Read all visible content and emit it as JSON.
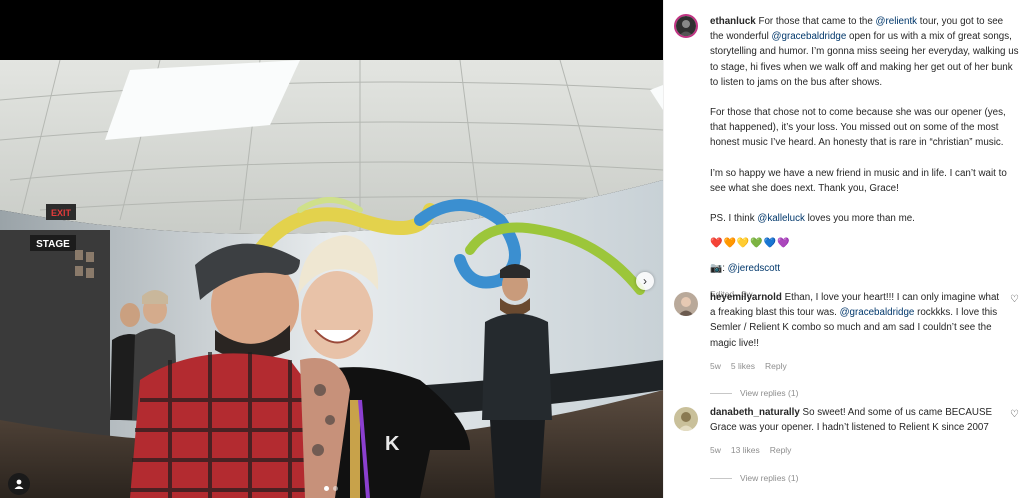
{
  "post": {
    "username": "ethanluck",
    "caption_p1_a": " For those that came to the ",
    "caption_p1_mention1": "@relientk",
    "caption_p1_b": " tour, you got to see the wonderful ",
    "caption_p1_mention2": "@gracebaldridge",
    "caption_p1_c": " open for us with a mix of great songs, storytelling and humor. I’m gonna miss seeing her everyday, walking us to stage, hi fives when we walk off and making her get out of her bunk to listen to jams on the bus after shows.",
    "caption_p2": "For those that chose not to come because she was our opener (yes, that happened), it’s your loss. You missed out on some of the most honest music I’ve heard. An honesty that is rare in “christian” music.",
    "caption_p3": "I’m so happy we have a new friend in music and in life. I can’t wait to see what she does next. Thank you, Grace!",
    "caption_p4_a": "PS. I think ",
    "caption_p4_mention": "@kalleluck",
    "caption_p4_b": " loves you more than me.",
    "hearts": "❤️🧡💛💚💙💜",
    "credit_emoji": "📷",
    "credit_sep": ": ",
    "credit_mention": "@jeredscott",
    "edited": "Edited · 5w"
  },
  "comments": [
    {
      "username": "heyemilyarnold",
      "text_a": " Ethan, I love your heart!!! I can only imagine what a freaking blast this tour was. ",
      "mention": "@gracebaldridge",
      "text_b": " rockkks. I love this Semler / Relient K combo so much and am sad I couldn’t see the magic live!!",
      "age": "5w",
      "likes": "5 likes",
      "reply": "Reply",
      "view_replies": "View replies (1)"
    },
    {
      "username": "danabeth_naturally",
      "text_a": " So sweet! And some of us came BECAUSE Grace was your opener. I hadn’t listened to Relient K since 2007",
      "mention": "",
      "text_b": "",
      "age": "5w",
      "likes": "13 likes",
      "reply": "Reply",
      "view_replies": "View replies (1)"
    }
  ],
  "photo": {
    "exit_sign": "EXIT",
    "stage_sign": "STAGE",
    "shirt_text": "K"
  },
  "icons": {
    "next": "chevron-right-icon",
    "tag": "user-tag-icon",
    "like": "heart-outline-icon"
  },
  "colors": {
    "link": "#00376b",
    "muted": "#8e8e8e",
    "text": "#262626"
  }
}
